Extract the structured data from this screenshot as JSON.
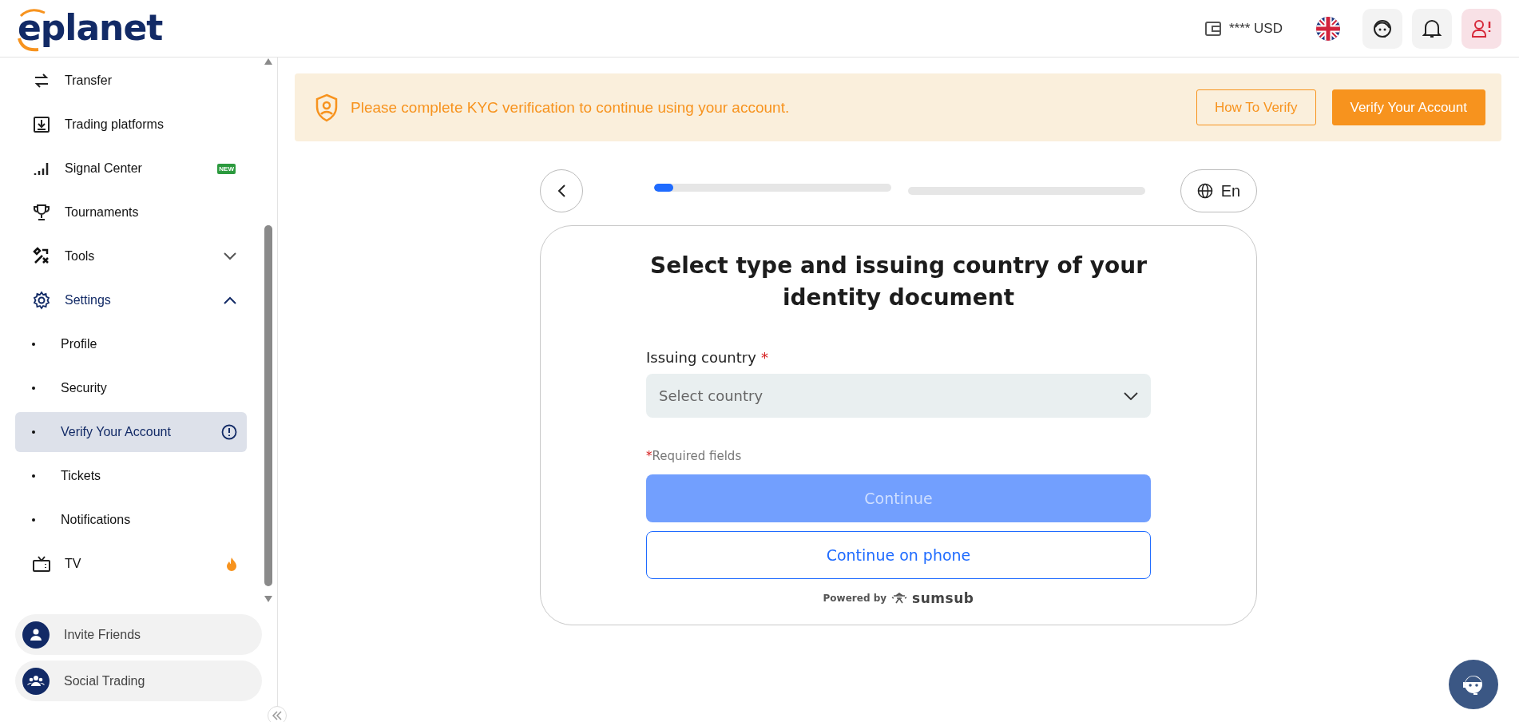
{
  "header": {
    "logo": "eplanet",
    "balance": "**** USD"
  },
  "sidebar": {
    "items": [
      {
        "label": "Transfer",
        "selected": false
      },
      {
        "label": "Trading platforms",
        "selected": false
      },
      {
        "label": "Signal Center",
        "selected": false,
        "badge": "NEW"
      },
      {
        "label": "Tournaments",
        "selected": false
      },
      {
        "label": "Tools",
        "selected": false,
        "expanded": false
      },
      {
        "label": "Settings",
        "selected": false,
        "expanded": true,
        "children": [
          {
            "label": "Profile",
            "selected": false
          },
          {
            "label": "Security",
            "selected": false
          },
          {
            "label": "Verify Your Account",
            "selected": true,
            "alert": true
          },
          {
            "label": "Tickets",
            "selected": false
          },
          {
            "label": "Notifications",
            "selected": false
          }
        ]
      },
      {
        "label": "TV",
        "selected": false,
        "hot": true
      }
    ],
    "footer_buttons": [
      {
        "label": "Invite Friends"
      },
      {
        "label": "Social Trading"
      }
    ]
  },
  "banner": {
    "message": "Please complete KYC verification to continue using your account.",
    "buttons": [
      {
        "label": "How To Verify",
        "kind": "outline"
      },
      {
        "label": "Verify Your Account",
        "kind": "primary"
      }
    ]
  },
  "verification": {
    "progress": [
      {
        "level": 0.08
      },
      {
        "level": 0
      }
    ],
    "language": "En",
    "title": "Select type and issuing country of your identity document",
    "field": {
      "label": "Issuing country",
      "required_mark": "*",
      "placeholder": "Select country"
    },
    "note": {
      "mark": "*",
      "text": "Required fields"
    },
    "buttons": [
      {
        "label": "Continue",
        "kind": "primary",
        "disabled": true
      },
      {
        "label": "Continue on phone",
        "kind": "outline",
        "disabled": false
      }
    ],
    "powered_by": "Powered by",
    "brand": "sumsub"
  }
}
